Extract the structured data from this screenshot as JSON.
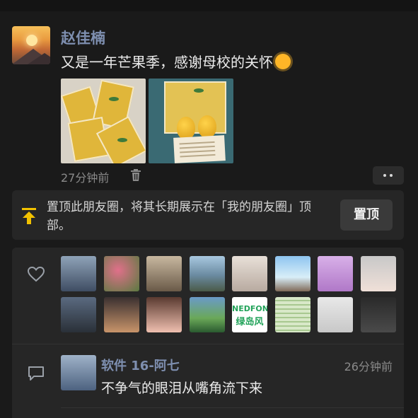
{
  "post": {
    "author": "赵佳楠",
    "text": "又是一年芒果季，感谢母校的关怀",
    "emoji": "sun-emoji",
    "time": "27分钟前",
    "more_label": "••"
  },
  "pin_panel": {
    "text": "置顶此朋友圈，将其长期展示在「我的朋友圈」顶部。",
    "button_label": "置顶"
  },
  "likes": {
    "count_visible": 16,
    "avatar_colors": [
      "#6f7f96",
      "#c76a7d",
      "#8a7a5a",
      "#7aa0c0",
      "#d8d0c8",
      "#6fa4d8",
      "#c59bd8",
      "#e8c8b8",
      "#5a6a80",
      "#c08a5a",
      "#e0b0a0",
      "#5a9a6a",
      "#ffffff",
      "#a8c8a0",
      "#e8e8e8",
      "#444444"
    ],
    "nedfon_line1": "NEDFON",
    "nedfon_line2": "绿岛风"
  },
  "comment": {
    "author": "软件 16-阿七",
    "time": "26分钟前",
    "text": "不争气的眼泪从嘴角流下来"
  },
  "colors": {
    "name_link": "#7e8fb0",
    "panel_bg": "#262626",
    "page_bg": "#1a1a1a",
    "pin_accent": "#f2c200"
  }
}
